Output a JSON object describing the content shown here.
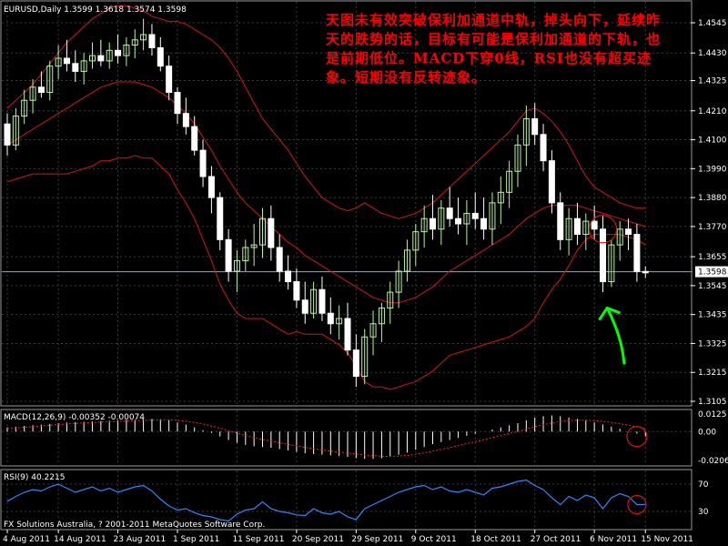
{
  "chart_data": [
    {
      "type": "candlestick",
      "title": "EURUSD,Daily  1.3599 1.3618 1.3574 1.3598",
      "symbol": "EURUSD",
      "timeframe": "Daily",
      "last_ohlc": {
        "open": 1.3599,
        "high": 1.3618,
        "low": 1.3574,
        "close": 1.3598
      },
      "current_price_label": "1.3598",
      "ylim": [
        1.3105,
        1.4545
      ],
      "y_ticks": [
        "1.4545",
        "1.4430",
        "1.4325",
        "1.4210",
        "1.4100",
        "1.3990",
        "1.3880",
        "1.3770",
        "1.3655",
        "1.3545",
        "1.3435",
        "1.3325",
        "1.3215",
        "1.3105"
      ],
      "x_ticks": [
        "4 Aug 2011",
        "14 Aug 2011",
        "23 Aug 2011",
        "1 Sep 2011",
        "11 Sep 2011",
        "20 Sep 2011",
        "29 Sep 2011",
        "9 Oct 2011",
        "18 Oct 2011",
        "27 Oct 2011",
        "6 Nov 2011",
        "15 Nov 2011"
      ],
      "x_tick_bar_index": [
        0,
        6,
        13,
        20,
        27,
        34,
        41,
        48,
        55,
        62,
        69,
        75
      ],
      "grid": true,
      "annotation": "天图未有效突破保利加通道中轨，掉头向下，延续昨天的跌势的话，目标有可能是保利加通道的下轨，也是前期低位。MACD下穿0线，RSI也没有超买迹象。短期没有反转迹象。",
      "ohlc": [
        [
          1.416,
          1.42,
          1.404,
          1.408
        ],
        [
          1.408,
          1.422,
          1.406,
          1.419
        ],
        [
          1.419,
          1.429,
          1.416,
          1.425
        ],
        [
          1.425,
          1.433,
          1.42,
          1.43
        ],
        [
          1.43,
          1.436,
          1.426,
          1.428
        ],
        [
          1.428,
          1.44,
          1.425,
          1.438
        ],
        [
          1.438,
          1.446,
          1.433,
          1.441
        ],
        [
          1.441,
          1.448,
          1.436,
          1.439
        ],
        [
          1.439,
          1.444,
          1.432,
          1.436
        ],
        [
          1.436,
          1.443,
          1.431,
          1.44
        ],
        [
          1.44,
          1.447,
          1.437,
          1.442
        ],
        [
          1.442,
          1.448,
          1.438,
          1.44
        ],
        [
          1.44,
          1.447,
          1.437,
          1.444
        ],
        [
          1.444,
          1.45,
          1.439,
          1.442
        ],
        [
          1.442,
          1.449,
          1.438,
          1.446
        ],
        [
          1.446,
          1.452,
          1.441,
          1.448
        ],
        [
          1.448,
          1.456,
          1.444,
          1.45
        ],
        [
          1.45,
          1.454,
          1.442,
          1.445
        ],
        [
          1.445,
          1.449,
          1.436,
          1.438
        ],
        [
          1.438,
          1.442,
          1.425,
          1.428
        ],
        [
          1.428,
          1.43,
          1.416,
          1.42
        ],
        [
          1.42,
          1.426,
          1.412,
          1.415
        ],
        [
          1.415,
          1.419,
          1.404,
          1.406
        ],
        [
          1.406,
          1.41,
          1.392,
          1.396
        ],
        [
          1.396,
          1.4,
          1.382,
          1.388
        ],
        [
          1.388,
          1.39,
          1.368,
          1.372
        ],
        [
          1.372,
          1.376,
          1.356,
          1.36
        ],
        [
          1.36,
          1.368,
          1.352,
          1.364
        ],
        [
          1.364,
          1.372,
          1.36,
          1.369
        ],
        [
          1.369,
          1.378,
          1.362,
          1.37
        ],
        [
          1.37,
          1.384,
          1.365,
          1.38
        ],
        [
          1.38,
          1.385,
          1.364,
          1.369
        ],
        [
          1.369,
          1.374,
          1.356,
          1.36
        ],
        [
          1.36,
          1.366,
          1.353,
          1.356
        ],
        [
          1.356,
          1.361,
          1.346,
          1.349
        ],
        [
          1.349,
          1.356,
          1.34,
          1.344
        ],
        [
          1.344,
          1.356,
          1.342,
          1.353
        ],
        [
          1.353,
          1.358,
          1.341,
          1.344
        ],
        [
          1.344,
          1.35,
          1.336,
          1.34
        ],
        [
          1.34,
          1.347,
          1.334,
          1.342
        ],
        [
          1.342,
          1.348,
          1.328,
          1.33
        ],
        [
          1.33,
          1.336,
          1.316,
          1.32
        ],
        [
          1.32,
          1.338,
          1.317,
          1.335
        ],
        [
          1.335,
          1.345,
          1.328,
          1.34
        ],
        [
          1.34,
          1.348,
          1.333,
          1.346
        ],
        [
          1.346,
          1.356,
          1.34,
          1.352
        ],
        [
          1.352,
          1.364,
          1.346,
          1.36
        ],
        [
          1.36,
          1.372,
          1.356,
          1.368
        ],
        [
          1.368,
          1.378,
          1.362,
          1.375
        ],
        [
          1.375,
          1.385,
          1.369,
          1.38
        ],
        [
          1.38,
          1.389,
          1.372,
          1.376
        ],
        [
          1.376,
          1.387,
          1.37,
          1.384
        ],
        [
          1.384,
          1.392,
          1.377,
          1.38
        ],
        [
          1.38,
          1.388,
          1.374,
          1.378
        ],
        [
          1.378,
          1.387,
          1.37,
          1.382
        ],
        [
          1.382,
          1.39,
          1.376,
          1.38
        ],
        [
          1.38,
          1.388,
          1.372,
          1.376
        ],
        [
          1.376,
          1.39,
          1.37,
          1.386
        ],
        [
          1.386,
          1.396,
          1.378,
          1.39
        ],
        [
          1.39,
          1.402,
          1.384,
          1.398
        ],
        [
          1.398,
          1.412,
          1.392,
          1.408
        ],
        [
          1.408,
          1.423,
          1.4,
          1.418
        ],
        [
          1.418,
          1.424,
          1.408,
          1.412
        ],
        [
          1.412,
          1.416,
          1.398,
          1.402
        ],
        [
          1.402,
          1.406,
          1.382,
          1.386
        ],
        [
          1.386,
          1.39,
          1.368,
          1.372
        ],
        [
          1.372,
          1.384,
          1.366,
          1.38
        ],
        [
          1.38,
          1.386,
          1.37,
          1.374
        ],
        [
          1.374,
          1.382,
          1.368,
          1.379
        ],
        [
          1.379,
          1.385,
          1.372,
          1.376
        ],
        [
          1.376,
          1.381,
          1.352,
          1.356
        ],
        [
          1.356,
          1.372,
          1.354,
          1.37
        ],
        [
          1.37,
          1.379,
          1.364,
          1.376
        ],
        [
          1.376,
          1.38,
          1.368,
          1.374
        ],
        [
          1.374,
          1.378,
          1.356,
          1.3599
        ],
        [
          1.3599,
          1.3618,
          1.3574,
          1.3598
        ]
      ],
      "bollinger": {
        "middle": [
          1.408,
          1.41,
          1.412,
          1.414,
          1.416,
          1.418,
          1.42,
          1.422,
          1.424,
          1.426,
          1.428,
          1.43,
          1.431,
          1.432,
          1.432,
          1.432,
          1.431,
          1.43,
          1.428,
          1.426,
          1.423,
          1.42,
          1.416,
          1.411,
          1.406,
          1.4,
          1.395,
          1.39,
          1.386,
          1.383,
          1.38,
          1.377,
          1.374,
          1.371,
          1.369,
          1.366,
          1.364,
          1.362,
          1.36,
          1.358,
          1.356,
          1.354,
          1.352,
          1.35,
          1.349,
          1.348,
          1.348,
          1.349,
          1.35,
          1.352,
          1.354,
          1.357,
          1.36,
          1.362,
          1.364,
          1.366,
          1.368,
          1.37,
          1.372,
          1.374,
          1.377,
          1.38,
          1.382,
          1.384,
          1.385,
          1.385,
          1.385,
          1.385,
          1.384,
          1.383,
          1.382,
          1.381,
          1.38,
          1.379,
          1.378,
          1.377
        ],
        "upper": [
          1.422,
          1.425,
          1.428,
          1.431,
          1.435,
          1.439,
          1.443,
          1.447,
          1.45,
          1.453,
          1.456,
          1.458,
          1.46,
          1.461,
          1.461,
          1.46,
          1.459,
          1.457,
          1.456,
          1.455,
          1.455,
          1.454,
          1.452,
          1.45,
          1.448,
          1.445,
          1.441,
          1.436,
          1.43,
          1.424,
          1.418,
          1.414,
          1.41,
          1.406,
          1.401,
          1.396,
          1.392,
          1.388,
          1.386,
          1.384,
          1.383,
          1.384,
          1.386,
          1.384,
          1.382,
          1.381,
          1.38,
          1.381,
          1.382,
          1.384,
          1.386,
          1.389,
          1.392,
          1.395,
          1.398,
          1.401,
          1.404,
          1.407,
          1.41,
          1.413,
          1.417,
          1.421,
          1.422,
          1.42,
          1.417,
          1.413,
          1.408,
          1.402,
          1.396,
          1.392,
          1.39,
          1.388,
          1.386,
          1.385,
          1.384,
          1.384
        ],
        "lower": [
          1.394,
          1.395,
          1.396,
          1.397,
          1.397,
          1.397,
          1.397,
          1.397,
          1.398,
          1.399,
          1.4,
          1.402,
          1.402,
          1.403,
          1.403,
          1.404,
          1.403,
          1.403,
          1.4,
          1.397,
          1.391,
          1.386,
          1.38,
          1.372,
          1.364,
          1.355,
          1.349,
          1.344,
          1.342,
          1.342,
          1.342,
          1.34,
          1.338,
          1.336,
          1.337,
          1.336,
          1.336,
          1.336,
          1.334,
          1.332,
          1.329,
          1.324,
          1.318,
          1.316,
          1.316,
          1.315,
          1.316,
          1.317,
          1.318,
          1.32,
          1.322,
          1.325,
          1.328,
          1.329,
          1.33,
          1.331,
          1.332,
          1.333,
          1.334,
          1.335,
          1.337,
          1.339,
          1.342,
          1.348,
          1.353,
          1.357,
          1.362,
          1.368,
          1.372,
          1.374,
          1.374,
          1.374,
          1.374,
          1.373,
          1.372,
          1.37
        ]
      },
      "markers": [
        {
          "type": "circle",
          "bar_index": 70,
          "price": 1.376
        },
        {
          "type": "arrow",
          "color": "#00ff00",
          "from": {
            "bar_index": 72.5,
            "price": 1.325
          },
          "to": {
            "bar_index": 70.5,
            "price": 1.346
          }
        }
      ]
    },
    {
      "type": "bar",
      "title": "MACD(12,26,9) -0.00352 -0.00074",
      "ylim": [
        -0.0206,
        0.0125
      ],
      "y_ticks": [
        "0.0125",
        "0.00",
        "-0.0206"
      ],
      "values": [
        0.003,
        0.0035,
        0.004,
        0.0045,
        0.005,
        0.0055,
        0.006,
        0.0065,
        0.0068,
        0.007,
        0.0072,
        0.0075,
        0.0078,
        0.008,
        0.0082,
        0.0085,
        0.0088,
        0.009,
        0.0088,
        0.008,
        0.0065,
        0.005,
        0.003,
        0.001,
        -0.001,
        -0.0035,
        -0.006,
        -0.008,
        -0.0095,
        -0.0105,
        -0.011,
        -0.0115,
        -0.0125,
        -0.0135,
        -0.0145,
        -0.0155,
        -0.016,
        -0.0165,
        -0.017,
        -0.0175,
        -0.018,
        -0.019,
        -0.0195,
        -0.0195,
        -0.019,
        -0.018,
        -0.0165,
        -0.015,
        -0.013,
        -0.011,
        -0.009,
        -0.0075,
        -0.006,
        -0.0045,
        -0.003,
        -0.0015,
        0.0,
        0.0015,
        0.003,
        0.0045,
        0.006,
        0.008,
        0.01,
        0.011,
        0.0115,
        0.011,
        0.01,
        0.009,
        0.008,
        0.0065,
        0.005,
        0.0035,
        0.002,
        0.0005,
        -0.0015,
        -0.0035
      ],
      "signal": [
        0.002,
        0.0025,
        0.003,
        0.0035,
        0.004,
        0.0045,
        0.005,
        0.0055,
        0.0058,
        0.0062,
        0.0065,
        0.0068,
        0.007,
        0.0073,
        0.0075,
        0.0078,
        0.008,
        0.0082,
        0.0084,
        0.0084,
        0.008,
        0.0074,
        0.0065,
        0.0054,
        0.004,
        0.0024,
        0.0007,
        -0.0011,
        -0.0028,
        -0.0043,
        -0.0057,
        -0.0068,
        -0.008,
        -0.0091,
        -0.0102,
        -0.0113,
        -0.0122,
        -0.0131,
        -0.0139,
        -0.0146,
        -0.0153,
        -0.016,
        -0.0167,
        -0.0172,
        -0.0176,
        -0.0177,
        -0.0175,
        -0.017,
        -0.0162,
        -0.0152,
        -0.014,
        -0.0127,
        -0.0114,
        -0.01,
        -0.0086,
        -0.0072,
        -0.0058,
        -0.0043,
        -0.0029,
        -0.0014,
        0.0001,
        0.0017,
        0.0034,
        0.0049,
        0.0062,
        0.0072,
        0.0078,
        0.0081,
        0.0081,
        0.0078,
        0.0072,
        0.0065,
        0.0056,
        0.0046,
        0.0034,
        0.002
      ],
      "marker": {
        "type": "circle",
        "bar_index": 74,
        "value": -0.0035
      }
    },
    {
      "type": "line",
      "title": "RSI(9) 40.2215",
      "ylim": [
        0,
        100
      ],
      "y_ticks": [
        "70",
        "30"
      ],
      "levels": [
        70,
        30
      ],
      "values": [
        45,
        52,
        58,
        62,
        60,
        66,
        70,
        64,
        58,
        62,
        66,
        60,
        64,
        58,
        62,
        66,
        68,
        60,
        48,
        38,
        32,
        34,
        28,
        24,
        22,
        18,
        16,
        26,
        32,
        34,
        44,
        34,
        30,
        28,
        25,
        24,
        34,
        28,
        26,
        30,
        22,
        18,
        34,
        40,
        46,
        52,
        58,
        62,
        66,
        68,
        62,
        66,
        60,
        58,
        62,
        58,
        54,
        64,
        66,
        70,
        74,
        76,
        68,
        62,
        50,
        40,
        52,
        46,
        54,
        50,
        34,
        50,
        56,
        52,
        40,
        40.2215
      ],
      "marker": {
        "type": "circle",
        "bar_index": 74,
        "value": 40
      }
    }
  ],
  "footer": {
    "copyright": "FX Solutions Australia, ? 2001-2011 MetaQuotes Software Corp."
  },
  "colors": {
    "background": "#000000",
    "grid": "#3a3a3a",
    "bull": "#b9f4a0",
    "bear": "#ffffff",
    "bollinger": "#d41515",
    "macd_hist": "#ffffff",
    "macd_signal": "#ff2020",
    "rsi": "#2e86ff",
    "annotation": "#ff0000",
    "circle": "#d41515",
    "arrow": "#00ff00"
  }
}
